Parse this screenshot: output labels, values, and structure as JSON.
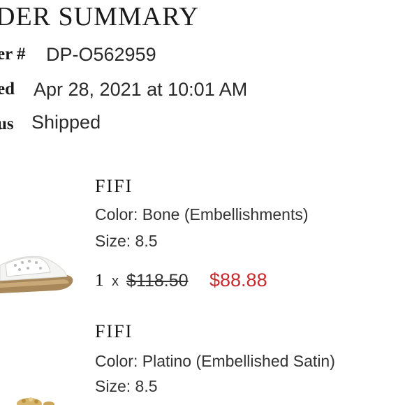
{
  "order_summary": {
    "title": "DER SUMMARY",
    "fields": [
      {
        "label": "er #",
        "value": "DP-O562959"
      },
      {
        "label": "ed",
        "value": "Apr 28, 2021 at 10:01 AM"
      },
      {
        "label": "us",
        "value": "Shipped"
      }
    ]
  },
  "items": [
    {
      "name": "FIFI",
      "color": "Color: Bone (Embellishments)",
      "size": "Size: 8.5",
      "quantity": "1",
      "times": "x",
      "original_price": "$118.50",
      "sale_price": "$88.88",
      "thumbnail_icon": "white-sandal-image"
    },
    {
      "name": "FIFI",
      "color": "Color: Platino (Embellished Satin)",
      "size": "Size: 8.5",
      "thumbnail_icon": "gold-sandal-image"
    }
  ],
  "colors": {
    "sale_price": "#c9282d",
    "text": "#1a1a1a"
  }
}
